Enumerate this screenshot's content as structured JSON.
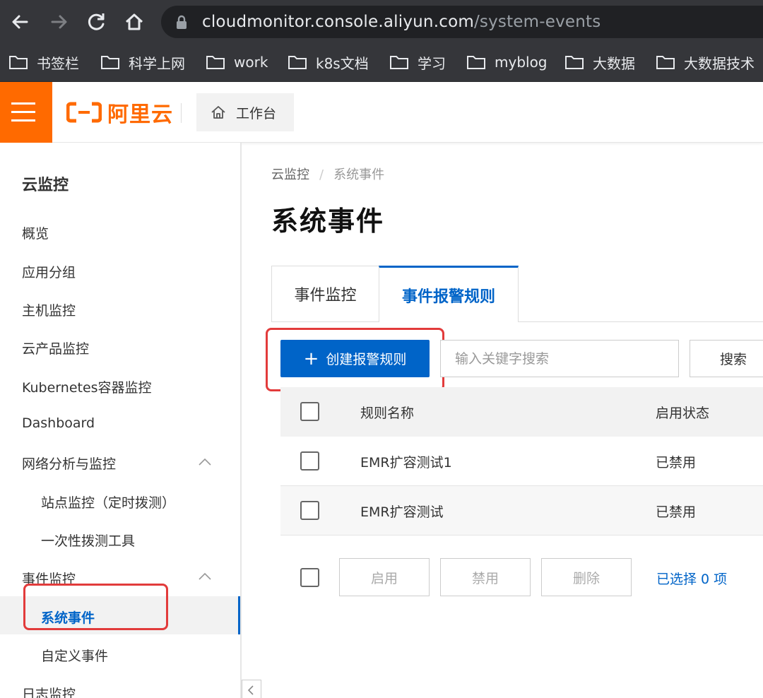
{
  "browser": {
    "url_host": "cloudmonitor.console.aliyun.com",
    "url_path": "/system-events",
    "bookmarks": [
      "书签栏",
      "科学上网",
      "work",
      "k8s文档",
      "学习",
      "myblog",
      "大数据",
      "大数据技术"
    ]
  },
  "header": {
    "logo_text": "阿里云",
    "workbench_label": "工作台"
  },
  "sidebar": {
    "title": "云监控",
    "items": [
      {
        "label": "概览"
      },
      {
        "label": "应用分组"
      },
      {
        "label": "主机监控"
      },
      {
        "label": "云产品监控"
      },
      {
        "label": "Kubernetes容器监控"
      },
      {
        "label": "Dashboard"
      },
      {
        "label": "网络分析与监控"
      },
      {
        "label": "站点监控（定时拨测）"
      },
      {
        "label": "一次性拨测工具"
      },
      {
        "label": "事件监控"
      },
      {
        "label": "系统事件"
      },
      {
        "label": "自定义事件"
      },
      {
        "label": "日志监控"
      }
    ]
  },
  "main": {
    "breadcrumb": [
      "云监控",
      "系统事件"
    ],
    "breadcrumb_sep": "/",
    "title": "系统事件",
    "tabs": [
      {
        "label": "事件监控"
      },
      {
        "label": "事件报警规则"
      }
    ],
    "create_button": "创建报警规则",
    "create_plus": "+",
    "search_placeholder": "输入关键字搜索",
    "search_button": "搜索",
    "table": {
      "columns": [
        "规则名称",
        "启用状态"
      ],
      "rows": [
        {
          "name": "EMR扩容测试1",
          "status": "已禁用"
        },
        {
          "name": "EMR扩容测试",
          "status": "已禁用"
        }
      ]
    },
    "footer": {
      "enable_button": "启用",
      "disable_button": "禁用",
      "delete_button": "删除",
      "selected_text": "已选择 0 项"
    }
  },
  "colors": {
    "brand_orange": "#ff6a00",
    "primary_blue": "#0064c8",
    "highlight_red": "#e23b3b"
  }
}
